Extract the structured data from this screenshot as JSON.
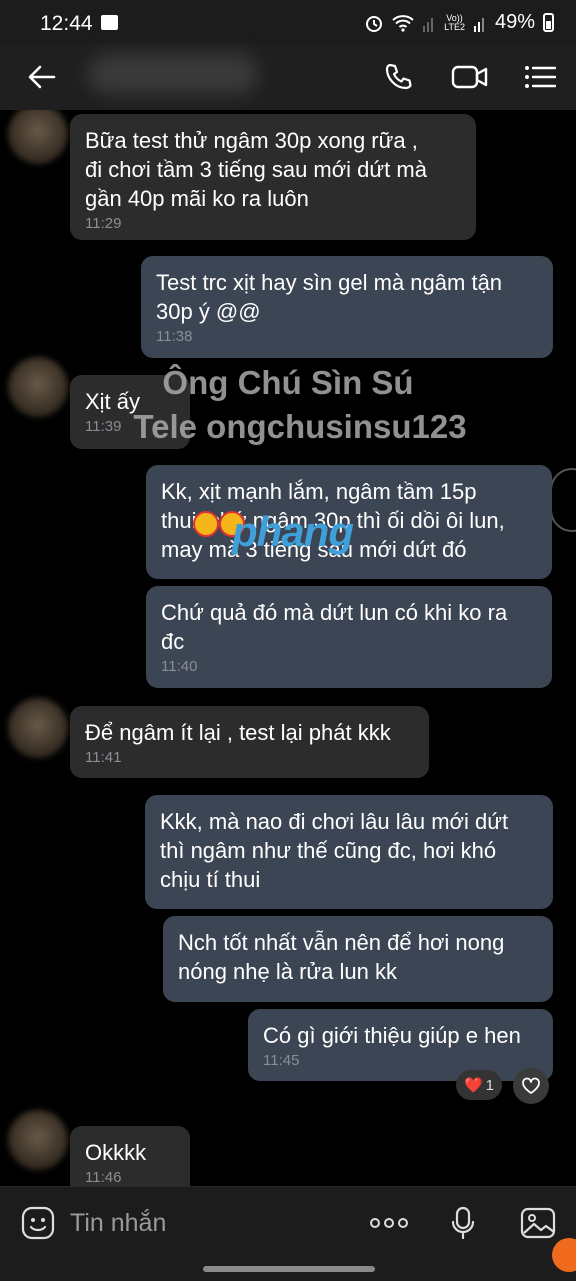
{
  "status": {
    "time": "12:44",
    "battery": "49%",
    "network": "Vo)) LTE2"
  },
  "header": {
    "back_icon": "arrow-left-icon",
    "call_icon": "phone-icon",
    "video_icon": "video-icon",
    "menu_icon": "menu-icon"
  },
  "messages": [
    {
      "dir": "in",
      "text": "Bữa test thử ngâm 30p xong rữa ,\nđi chơi tầm 3 tiếng sau mới dứt mà\ngần 40p mãi ko ra luôn",
      "time": "11:29"
    },
    {
      "dir": "out",
      "text": "Test trc xịt hay sìn gel mà ngâm tận\n30p ý @@",
      "time": "11:38"
    },
    {
      "dir": "in",
      "text": "Xịt ấy",
      "time": "11:39"
    },
    {
      "dir": "out",
      "text": "Kk, xịt mạnh lắm, ngâm tầm 15p\nthui, chứ ngâm 30p thì ối dồi ôi lun,\nmay mà 3 tiếng sau mới dứt đó",
      "time": ""
    },
    {
      "dir": "out",
      "text": "Chứ quả đó mà dứt lun có khi ko ra\nđc",
      "time": "11:40"
    },
    {
      "dir": "in",
      "text": "Để ngâm ít lại , test lại phát kkk",
      "time": "11:41"
    },
    {
      "dir": "out",
      "text": "Kkk, mà nao đi chơi lâu lâu mới dứt\nthì ngâm như thế cũng đc, hơi khó\nchịu tí thui",
      "time": ""
    },
    {
      "dir": "out",
      "text": "Nch tốt nhất vẫn nên để hơi nong\nnóng nhẹ là rửa lun kk",
      "time": ""
    },
    {
      "dir": "out",
      "text": "Có gì giới thiệu giúp e hen",
      "time": "11:45"
    },
    {
      "dir": "in",
      "text": "Okkkk",
      "time": "11:46"
    }
  ],
  "watermark": {
    "line1": "Ông Chú Sìn Sú",
    "line2": "Tele ongchusinsu123"
  },
  "logo": "phang",
  "reaction": {
    "emoji": "❤️",
    "count": "1"
  },
  "input": {
    "placeholder": "Tin nhắn"
  },
  "colors": {
    "bubble_in": "#2c2c2c",
    "bubble_out": "#3c4553",
    "accent_logo": "#3f9fd8"
  }
}
